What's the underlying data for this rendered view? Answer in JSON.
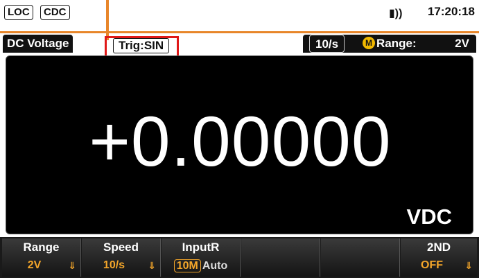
{
  "status": {
    "mode_tags": [
      "LOC",
      "CDC"
    ],
    "beep_icon": "speaker-icon",
    "time": "17:20:18"
  },
  "info_bar": {
    "function": "DC Voltage",
    "trigger": "Trig:SIN",
    "rate": "10/s",
    "manual_icon_letter": "M",
    "range_label": "Range:",
    "range_value": "2V"
  },
  "display": {
    "reading": "+0.00000",
    "unit": "VDC"
  },
  "softkeys": [
    {
      "label": "Range",
      "value": "2V"
    },
    {
      "label": "Speed",
      "value": "10/s"
    },
    {
      "label": "InputR",
      "selected": "10M",
      "other": "Auto"
    },
    {
      "label": "",
      "value": ""
    },
    {
      "label": "",
      "value": ""
    },
    {
      "label": "2ND",
      "value": "OFF"
    }
  ],
  "colors": {
    "accent_orange": "#e8862a",
    "highlight_red": "#e01818",
    "softkey_value": "#f4a62a"
  }
}
